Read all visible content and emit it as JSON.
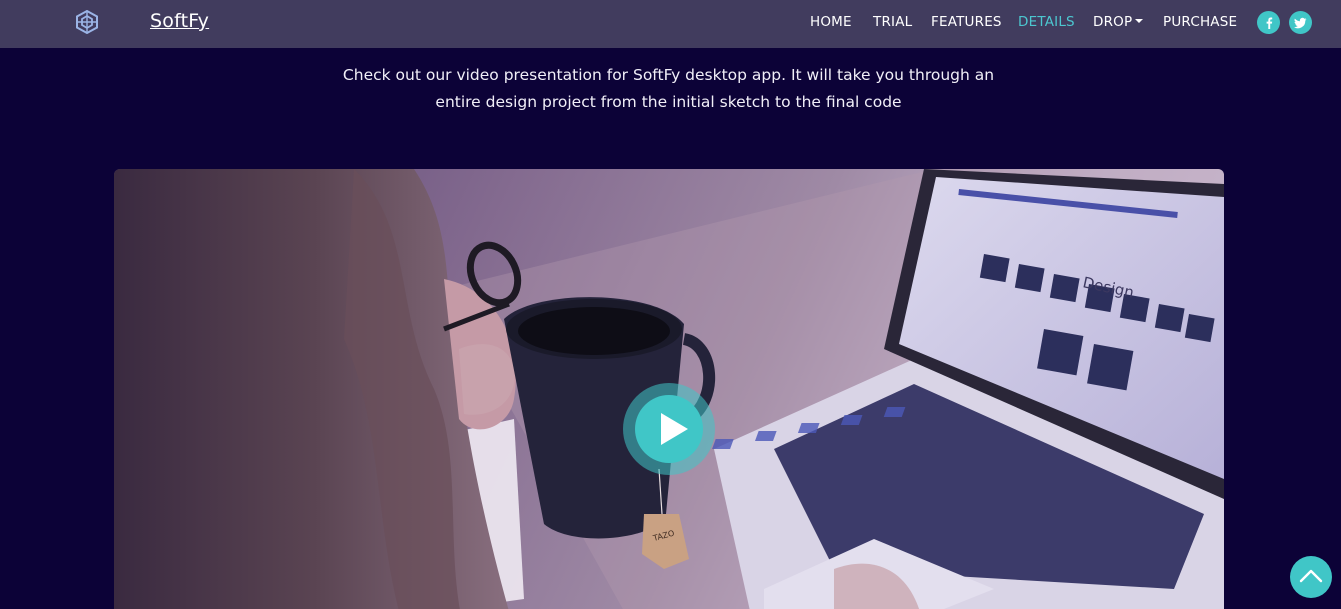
{
  "navbar": {
    "brand": "SoftFy",
    "logo_icon": "hexagon-logo-icon",
    "links": [
      "HOME",
      "TRIAL",
      "FEATURES",
      "DETAILS",
      "DROP",
      "PURCHASE"
    ],
    "active_link": "DETAILS",
    "social_icons": [
      "facebook-icon",
      "twitter-icon"
    ]
  },
  "intro": {
    "line1": "Check out our video presentation for SoftFy desktop app. It will take you through an",
    "line2": "entire design project from the initial sketch to the final code"
  },
  "video": {
    "laptop_screen_heading": "Design",
    "tea_tag_text": "TAZO",
    "play_icon": "play-icon"
  },
  "scroll_top_icon": "chevron-up-icon",
  "colors": {
    "page_background": "#0c0237",
    "navbar_background": "#413c5e",
    "accent": "#40c6c7",
    "active_link": "#4cc7d0"
  }
}
